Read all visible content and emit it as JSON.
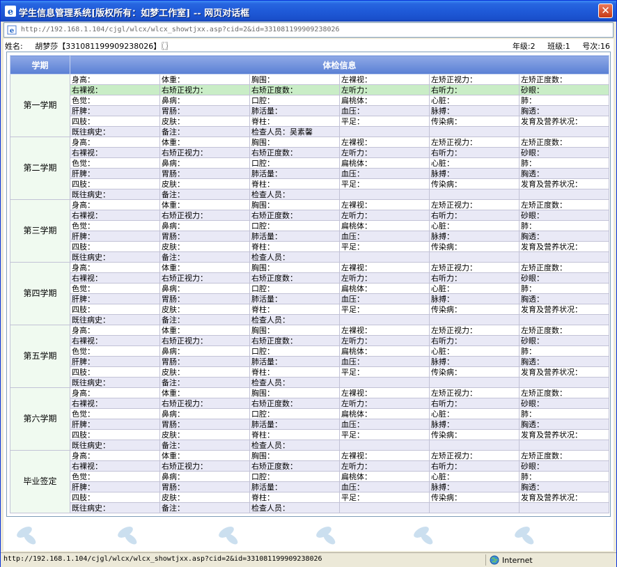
{
  "window": {
    "title": "学生信息管理系统[版权所有：如梦工作室] -- 网页对话框",
    "close_label": "✕"
  },
  "address": "http://192.168.1.104/cjgl/wlcx/wlcx_showtjxx.asp?cid=2&id=331081199909238026",
  "student": {
    "name_label": "姓名:",
    "name_value": "胡梦莎【331081199909238026】〖〗",
    "grade": "年级:2",
    "class": "班级:1",
    "number": "号次:16"
  },
  "table": {
    "header_term": "学期",
    "header_info": "体检信息"
  },
  "terms": [
    {
      "name": "第一学期",
      "rows": [
        [
          "身高：",
          "体重：",
          "胸围：",
          "左裸视：",
          "左矫正视力：",
          "左矫正度数："
        ],
        [
          "右裸视：",
          "右矫正视力：",
          "右矫正度数：",
          "左听力：",
          "右听力：",
          "砂眼："
        ],
        [
          "色觉：",
          "鼻病：",
          "口腔：",
          "扁桃体：",
          "心脏：",
          "肺："
        ],
        [
          "肝脾：",
          "胃肠：",
          "肺活量：",
          "血压：",
          "脉搏：",
          "胸透："
        ],
        [
          "四肢：",
          "皮肤：",
          "脊柱：",
          "平足：",
          "传染病：",
          "发育及营养状况："
        ],
        [
          "既往病史：",
          "备注：",
          "检查人员：吴素馨",
          "",
          "",
          ""
        ]
      ]
    },
    {
      "name": "第二学期",
      "rows": [
        [
          "身高：",
          "体重：",
          "胸围：",
          "左裸视：",
          "左矫正视力：",
          "左矫正度数："
        ],
        [
          "右裸视：",
          "右矫正视力：",
          "右矫正度数：",
          "左听力：",
          "右听力：",
          "砂眼："
        ],
        [
          "色觉：",
          "鼻病：",
          "口腔：",
          "扁桃体：",
          "心脏：",
          "肺："
        ],
        [
          "肝脾：",
          "胃肠：",
          "肺活量：",
          "血压：",
          "脉搏：",
          "胸透："
        ],
        [
          "四肢：",
          "皮肤：",
          "脊柱：",
          "平足：",
          "传染病：",
          "发育及营养状况："
        ],
        [
          "既往病史：",
          "备注：",
          "检查人员：",
          "",
          "",
          ""
        ]
      ]
    },
    {
      "name": "第三学期",
      "rows": [
        [
          "身高：",
          "体重：",
          "胸围：",
          "左裸视：",
          "左矫正视力：",
          "左矫正度数："
        ],
        [
          "右裸视：",
          "右矫正视力：",
          "右矫正度数：",
          "左听力：",
          "右听力：",
          "砂眼："
        ],
        [
          "色觉：",
          "鼻病：",
          "口腔：",
          "扁桃体：",
          "心脏：",
          "肺："
        ],
        [
          "肝脾：",
          "胃肠：",
          "肺活量：",
          "血压：",
          "脉搏：",
          "胸透："
        ],
        [
          "四肢：",
          "皮肤：",
          "脊柱：",
          "平足：",
          "传染病：",
          "发育及营养状况："
        ],
        [
          "既往病史：",
          "备注：",
          "检查人员：",
          "",
          "",
          ""
        ]
      ]
    },
    {
      "name": "第四学期",
      "rows": [
        [
          "身高：",
          "体重：",
          "胸围：",
          "左裸视：",
          "左矫正视力：",
          "左矫正度数："
        ],
        [
          "右裸视：",
          "右矫正视力：",
          "右矫正度数：",
          "左听力：",
          "右听力：",
          "砂眼："
        ],
        [
          "色觉：",
          "鼻病：",
          "口腔：",
          "扁桃体：",
          "心脏：",
          "肺："
        ],
        [
          "肝脾：",
          "胃肠：",
          "肺活量：",
          "血压：",
          "脉搏：",
          "胸透："
        ],
        [
          "四肢：",
          "皮肤：",
          "脊柱：",
          "平足：",
          "传染病：",
          "发育及营养状况："
        ],
        [
          "既往病史：",
          "备注：",
          "检查人员：",
          "",
          "",
          ""
        ]
      ]
    },
    {
      "name": "第五学期",
      "rows": [
        [
          "身高：",
          "体重：",
          "胸围：",
          "左裸视：",
          "左矫正视力：",
          "左矫正度数："
        ],
        [
          "右裸视：",
          "右矫正视力：",
          "右矫正度数：",
          "左听力：",
          "右听力：",
          "砂眼："
        ],
        [
          "色觉：",
          "鼻病：",
          "口腔：",
          "扁桃体：",
          "心脏：",
          "肺："
        ],
        [
          "肝脾：",
          "胃肠：",
          "肺活量：",
          "血压：",
          "脉搏：",
          "胸透："
        ],
        [
          "四肢：",
          "皮肤：",
          "脊柱：",
          "平足：",
          "传染病：",
          "发育及营养状况："
        ],
        [
          "既往病史：",
          "备注：",
          "检查人员：",
          "",
          "",
          ""
        ]
      ]
    },
    {
      "name": "第六学期",
      "rows": [
        [
          "身高：",
          "体重：",
          "胸围：",
          "左裸视：",
          "左矫正视力：",
          "左矫正度数："
        ],
        [
          "右裸视：",
          "右矫正视力：",
          "右矫正度数：",
          "左听力：",
          "右听力：",
          "砂眼："
        ],
        [
          "色觉：",
          "鼻病：",
          "口腔：",
          "扁桃体：",
          "心脏：",
          "肺："
        ],
        [
          "肝脾：",
          "胃肠：",
          "肺活量：",
          "血压：",
          "脉搏：",
          "胸透："
        ],
        [
          "四肢：",
          "皮肤：",
          "脊柱：",
          "平足：",
          "传染病：",
          "发育及营养状况："
        ],
        [
          "既往病史：",
          "备注：",
          "检查人员：",
          "",
          "",
          ""
        ]
      ]
    },
    {
      "name": "毕业签定",
      "rows": [
        [
          "身高：",
          "体重：",
          "胸围：",
          "左裸视：",
          "左矫正视力：",
          "左矫正度数："
        ],
        [
          "右裸视：",
          "右矫正视力：",
          "右矫正度数：",
          "左听力：",
          "右听力：",
          "砂眼："
        ],
        [
          "色觉：",
          "鼻病：",
          "口腔：",
          "扁桃体：",
          "心脏：",
          "肺："
        ],
        [
          "肝脾：",
          "胃肠：",
          "肺活量：",
          "血压：",
          "脉搏：",
          "胸透："
        ],
        [
          "四肢：",
          "皮肤：",
          "脊柱：",
          "平足：",
          "传染病：",
          "发育及营养状况："
        ],
        [
          "既往病史：",
          "备注：",
          "检查人员：",
          "",
          "",
          ""
        ]
      ]
    }
  ],
  "status": {
    "url": "http://192.168.1.104/cjgl/wlcx/wlcx_showtjxx.asp?cid=2&id=331081199909238026",
    "zone": "Internet"
  },
  "colors": {
    "header_blue": "#6d8fdc",
    "highlight_row": "#c9edc6",
    "term_cell": "#f0faf0"
  }
}
